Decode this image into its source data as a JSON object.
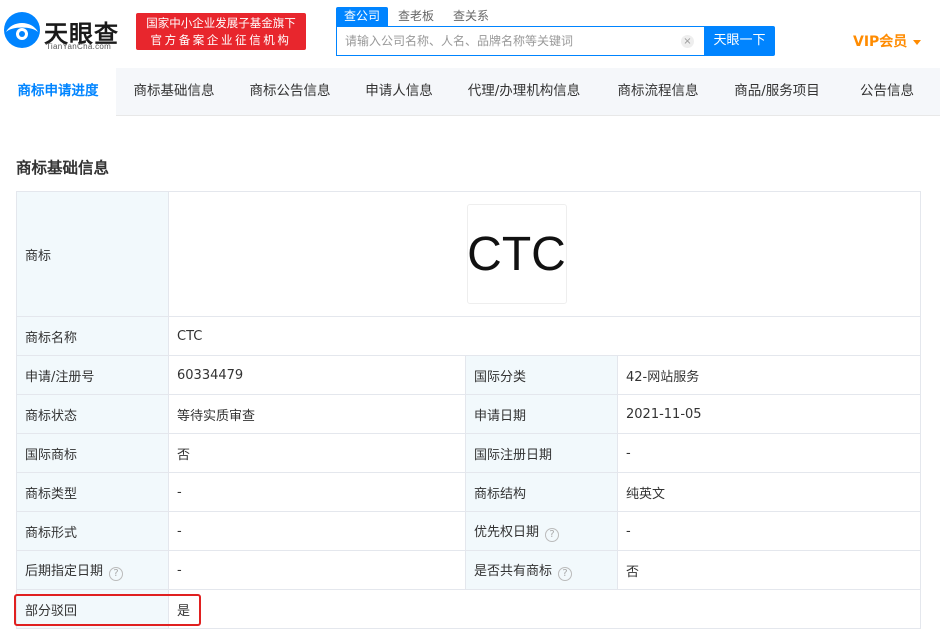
{
  "header": {
    "logo_title": "天眼查",
    "logo_sub": "TianYanCha.com",
    "badge_line1": "国家中小企业发展子基金旗下",
    "badge_line2": "官方备案企业征信机构",
    "search_tabs": [
      "查公司",
      "查老板",
      "查关系"
    ],
    "search_placeholder": "请输入公司名称、人名、品牌名称等关键词",
    "clear_icon": "×",
    "search_button": "天眼一下",
    "vip_label": "VIP会员",
    "accent_color": "#0084ff"
  },
  "nav": {
    "tabs": [
      "商标申请进度",
      "商标基础信息",
      "商标公告信息",
      "申请人信息",
      "代理/办理机构信息",
      "商标流程信息",
      "商品/服务项目",
      "公告信息"
    ]
  },
  "section": {
    "title": "商标基础信息"
  },
  "table": {
    "trademark_label": "商标",
    "trademark_image_text": "CTC",
    "name_label": "商标名称",
    "name_value": "CTC",
    "reg_no_label": "申请/注册号",
    "reg_no_value": "60334479",
    "intl_class_label": "国际分类",
    "intl_class_value": "42-网站服务",
    "status_label": "商标状态",
    "status_value": "等待实质审查",
    "apply_date_label": "申请日期",
    "apply_date_value": "2021-11-05",
    "intl_tm_label": "国际商标",
    "intl_tm_value": "否",
    "intl_reg_date_label": "国际注册日期",
    "intl_reg_date_value": "-",
    "type_label": "商标类型",
    "type_value": "-",
    "structure_label": "商标结构",
    "structure_value": "纯英文",
    "form_label": "商标形式",
    "form_value": "-",
    "priority_date_label": "优先权日期",
    "priority_date_value": "-",
    "later_date_label": "后期指定日期",
    "later_date_value": "-",
    "shared_label": "是否共有商标",
    "shared_value": "否",
    "partial_reject_label": "部分驳回",
    "partial_reject_value": "是",
    "help_glyph": "?"
  }
}
